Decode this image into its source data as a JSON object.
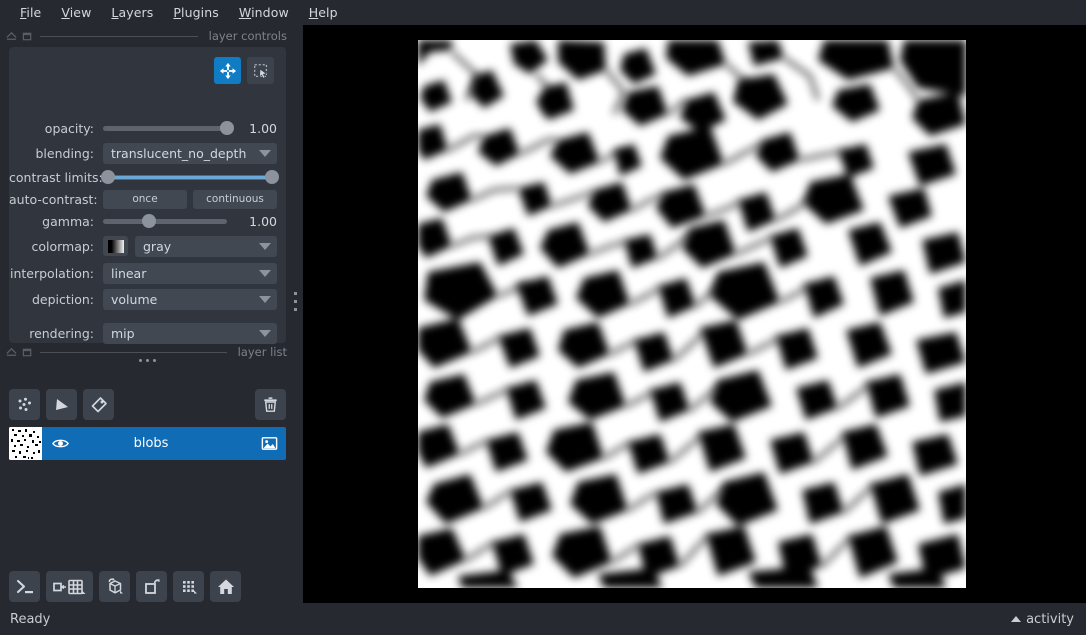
{
  "app": {
    "background": "#262930",
    "panel_background": "#31363e",
    "accent": "#0f7cc4",
    "selection": "#0f6cb5",
    "canvas_background": "#000000"
  },
  "menubar": {
    "items": [
      {
        "label": "File",
        "mnemonic": "F",
        "rest": "ile"
      },
      {
        "label": "View",
        "mnemonic": "V",
        "rest": "iew"
      },
      {
        "label": "Layers",
        "mnemonic": "L",
        "rest": "ayers"
      },
      {
        "label": "Plugins",
        "mnemonic": "P",
        "rest": "lugins"
      },
      {
        "label": "Window",
        "mnemonic": "W",
        "rest": "indow"
      },
      {
        "label": "Help",
        "mnemonic": "H",
        "rest": "elp"
      }
    ]
  },
  "layer_controls": {
    "dock_title": "layer controls",
    "mode_buttons": [
      {
        "name": "pan-zoom",
        "active": true
      },
      {
        "name": "transform",
        "active": false
      }
    ],
    "opacity": {
      "label": "opacity:",
      "value": "1.00",
      "percent": 100
    },
    "blending": {
      "label": "blending:",
      "value": "translucent_no_depth"
    },
    "contrast_limits": {
      "label": "contrast limits:",
      "low_percent": 0,
      "high_percent": 100
    },
    "auto_contrast": {
      "label": "auto-contrast:",
      "once": "once",
      "continuous": "continuous"
    },
    "gamma": {
      "label": "gamma:",
      "value": "1.00",
      "percent": 37
    },
    "colormap": {
      "label": "colormap:",
      "value": "gray"
    },
    "interpolation": {
      "label": "interpolation:",
      "value": "linear"
    },
    "depiction": {
      "label": "depiction:",
      "value": "volume"
    },
    "rendering": {
      "label": "rendering:",
      "value": "mip"
    }
  },
  "layer_list": {
    "dock_title": "layer list",
    "buttons": [
      {
        "name": "new-points-layer"
      },
      {
        "name": "new-shapes-layer"
      },
      {
        "name": "new-labels-layer"
      },
      {
        "name": "delete-layer"
      }
    ],
    "layers": [
      {
        "name": "blobs",
        "visible": true,
        "selected": true,
        "type": "image"
      }
    ]
  },
  "viewer_tools": [
    {
      "name": "console"
    },
    {
      "name": "ndisplay-toggle"
    },
    {
      "name": "roll-dimensions"
    },
    {
      "name": "transpose-dimensions"
    },
    {
      "name": "grid-view"
    },
    {
      "name": "reset-view-home"
    }
  ],
  "statusbar": {
    "status": "Ready",
    "activity": "activity"
  }
}
